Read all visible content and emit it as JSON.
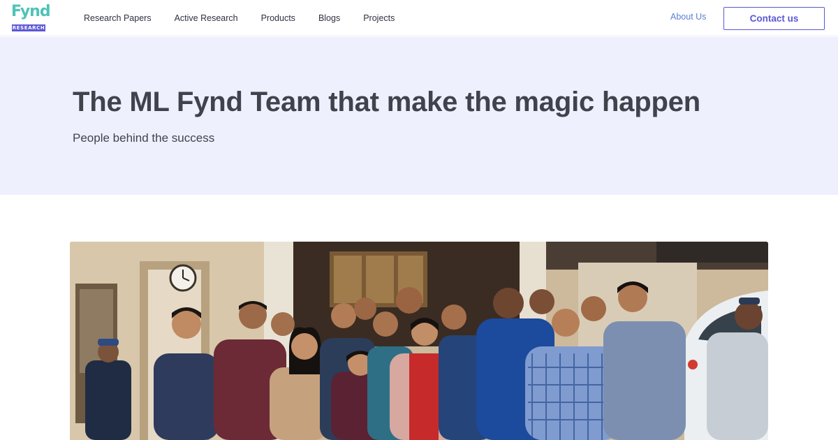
{
  "brand": {
    "logo_word": "Fynd",
    "logo_badge": "RESEARCH",
    "colors": {
      "teal": "#4fc3b7",
      "purple": "#5b57d6"
    }
  },
  "nav": {
    "items": [
      {
        "label": "Research Papers"
      },
      {
        "label": "Active Research"
      },
      {
        "label": "Products"
      },
      {
        "label": "Blogs"
      },
      {
        "label": "Projects"
      }
    ],
    "about_label": "About Us",
    "contact_label": "Contact us"
  },
  "hero": {
    "title": "The ML Fynd Team that make the magic happen",
    "subtitle": "People behind the success",
    "background": "#eff0fe"
  },
  "photo": {
    "subject": "team-group-photo"
  }
}
